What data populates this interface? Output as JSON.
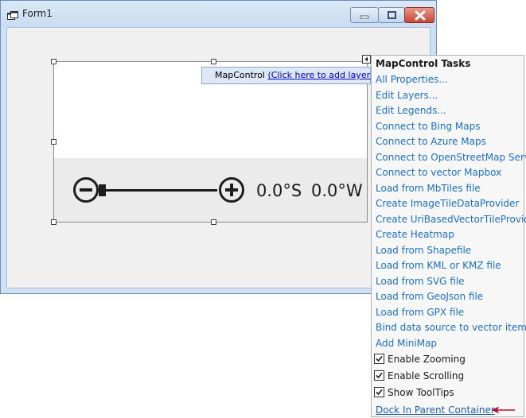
{
  "window": {
    "title": "Form1",
    "minimize_icon": "minimize-icon",
    "maximize_icon": "maximize-icon",
    "close_icon": "close-icon",
    "close_color": "#c7483a"
  },
  "map_control": {
    "layer_hint_prefix": "MapControl",
    "layer_hint_link": "(Click here to add layer)",
    "latitude": "0.0°S",
    "longitude": "0.0°W",
    "zoom_out_icon": "minus-circle-icon",
    "zoom_in_icon": "plus-circle-icon",
    "zoom_level": 0
  },
  "tasks": {
    "title": "MapControl Tasks",
    "links": [
      "All Properties...",
      "Edit Layers...",
      "Edit Legends...",
      "Connect to Bing Maps",
      "Connect to Azure Maps",
      "Connect to OpenStreetMap Server",
      "Connect to vector Mapbox",
      "Load from MbTiles file",
      "Create ImageTileDataProvider",
      "Create UriBasedVectorTileProvider",
      "Create Heatmap",
      "Load from Shapefile",
      "Load from KML or KMZ file",
      "Load from SVG file",
      "Load from GeoJson file",
      "Load from GPX file",
      "Bind data source to vector items",
      "Add MiniMap"
    ],
    "checks": [
      {
        "label": "Enable Zooming",
        "checked": true
      },
      {
        "label": "Enable Scrolling",
        "checked": true
      },
      {
        "label": "Show ToolTips",
        "checked": true
      }
    ],
    "dock_link": "Dock In Parent Container",
    "link_color": "#1c6fc4",
    "annotation_arrow_color": "#b8102a"
  }
}
